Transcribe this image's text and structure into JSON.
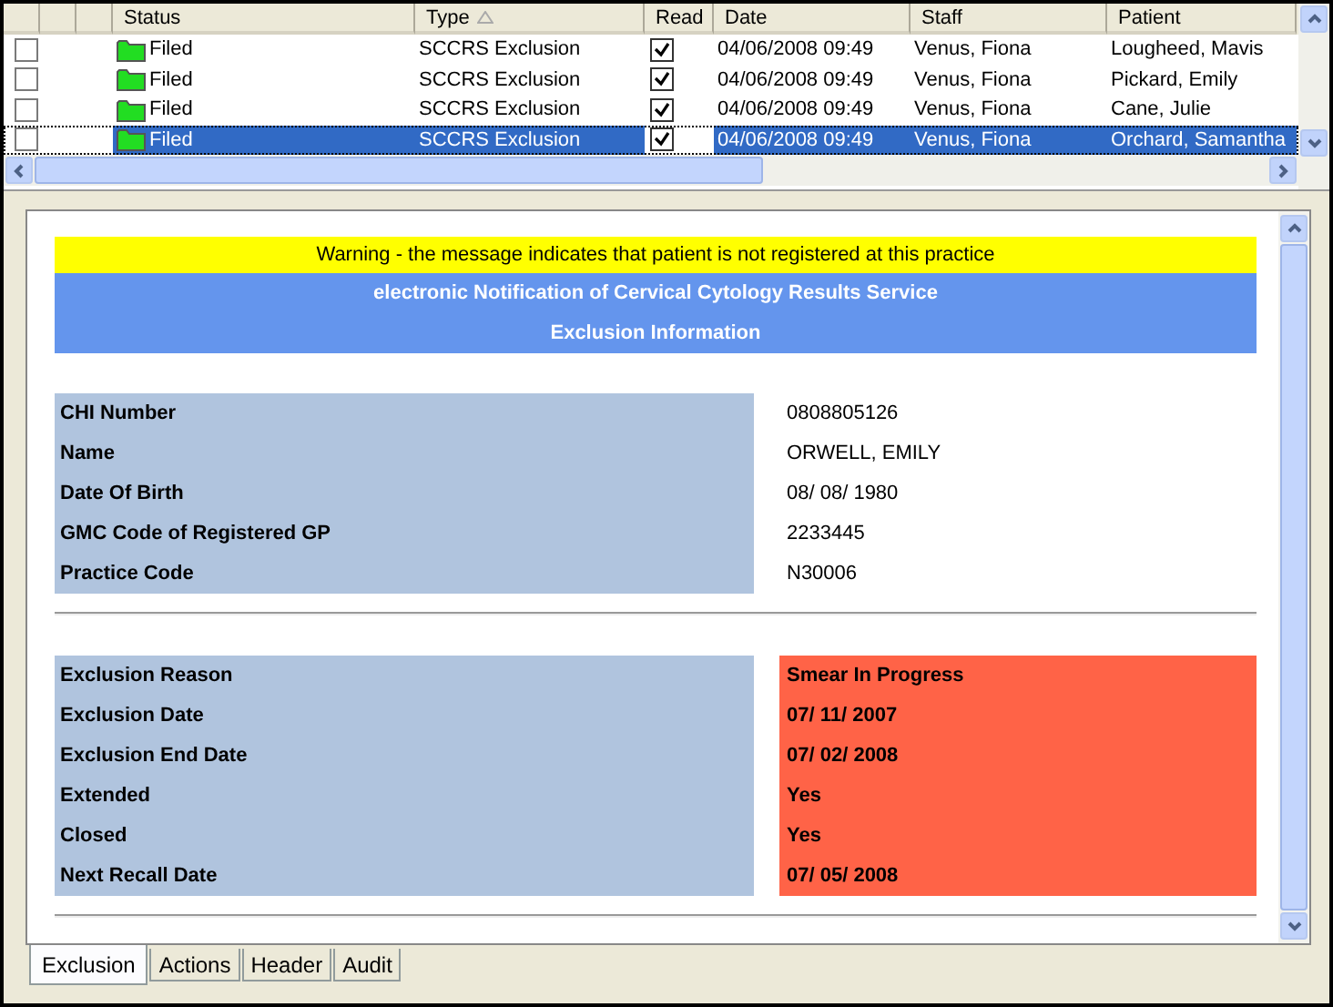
{
  "grid": {
    "columns": [
      {
        "kind": "blank"
      },
      {
        "kind": "blank"
      },
      {
        "kind": "blank"
      },
      {
        "label": "Status",
        "kind": "text"
      },
      {
        "label": "Type",
        "kind": "sorted"
      },
      {
        "label": "Read",
        "kind": "text"
      },
      {
        "label": "Date",
        "kind": "text"
      },
      {
        "label": "Staff",
        "kind": "text"
      },
      {
        "label": "Patient",
        "kind": "text"
      }
    ],
    "rows": [
      {
        "checked": false,
        "status": "Filed",
        "type": "SCCRS Exclusion",
        "read": true,
        "date": "04/06/2008 09:49",
        "staff": "Venus, Fiona",
        "patient": "Lougheed, Mavis",
        "selected": false
      },
      {
        "checked": false,
        "status": "Filed",
        "type": "SCCRS Exclusion",
        "read": true,
        "date": "04/06/2008 09:49",
        "staff": "Venus, Fiona",
        "patient": "Pickard, Emily",
        "selected": false
      },
      {
        "checked": false,
        "status": "Filed",
        "type": "SCCRS Exclusion",
        "read": true,
        "date": "04/06/2008 09:49",
        "staff": "Venus, Fiona",
        "patient": "Cane, Julie",
        "selected": false
      },
      {
        "checked": false,
        "status": "Filed",
        "type": "SCCRS Exclusion",
        "read": true,
        "date": "04/06/2008 09:49",
        "staff": "Venus, Fiona",
        "patient": "Orchard, Samantha",
        "selected": true
      }
    ]
  },
  "report": {
    "warning": "Warning - the message indicates that patient is not registered at this practice",
    "title": "electronic Notification of Cervical Cytology Results Service",
    "subtitle": "Exclusion Information",
    "sections": [
      {
        "highlight": false,
        "fields": [
          {
            "label": "CHI Number",
            "value": "0808805126"
          },
          {
            "label": "Name",
            "value": "ORWELL, EMILY"
          },
          {
            "label": "Date Of Birth",
            "value": "08/ 08/ 1980"
          },
          {
            "label": "GMC Code of Registered GP",
            "value": "2233445"
          },
          {
            "label": "Practice Code",
            "value": "N30006"
          }
        ]
      },
      {
        "highlight": true,
        "fields": [
          {
            "label": "Exclusion Reason",
            "value": "Smear In Progress"
          },
          {
            "label": "Exclusion Date",
            "value": "07/ 11/ 2007"
          },
          {
            "label": "Exclusion End Date",
            "value": "07/ 02/ 2008"
          },
          {
            "label": "Extended",
            "value": "Yes"
          },
          {
            "label": "Closed",
            "value": "Yes"
          },
          {
            "label": "Next Recall Date",
            "value": "07/ 05/ 2008"
          }
        ]
      }
    ]
  },
  "tabs": [
    {
      "label": "Exclusion",
      "selected": true
    },
    {
      "label": "Actions",
      "selected": false
    },
    {
      "label": "Header",
      "selected": false
    },
    {
      "label": "Audit",
      "selected": false
    }
  ]
}
